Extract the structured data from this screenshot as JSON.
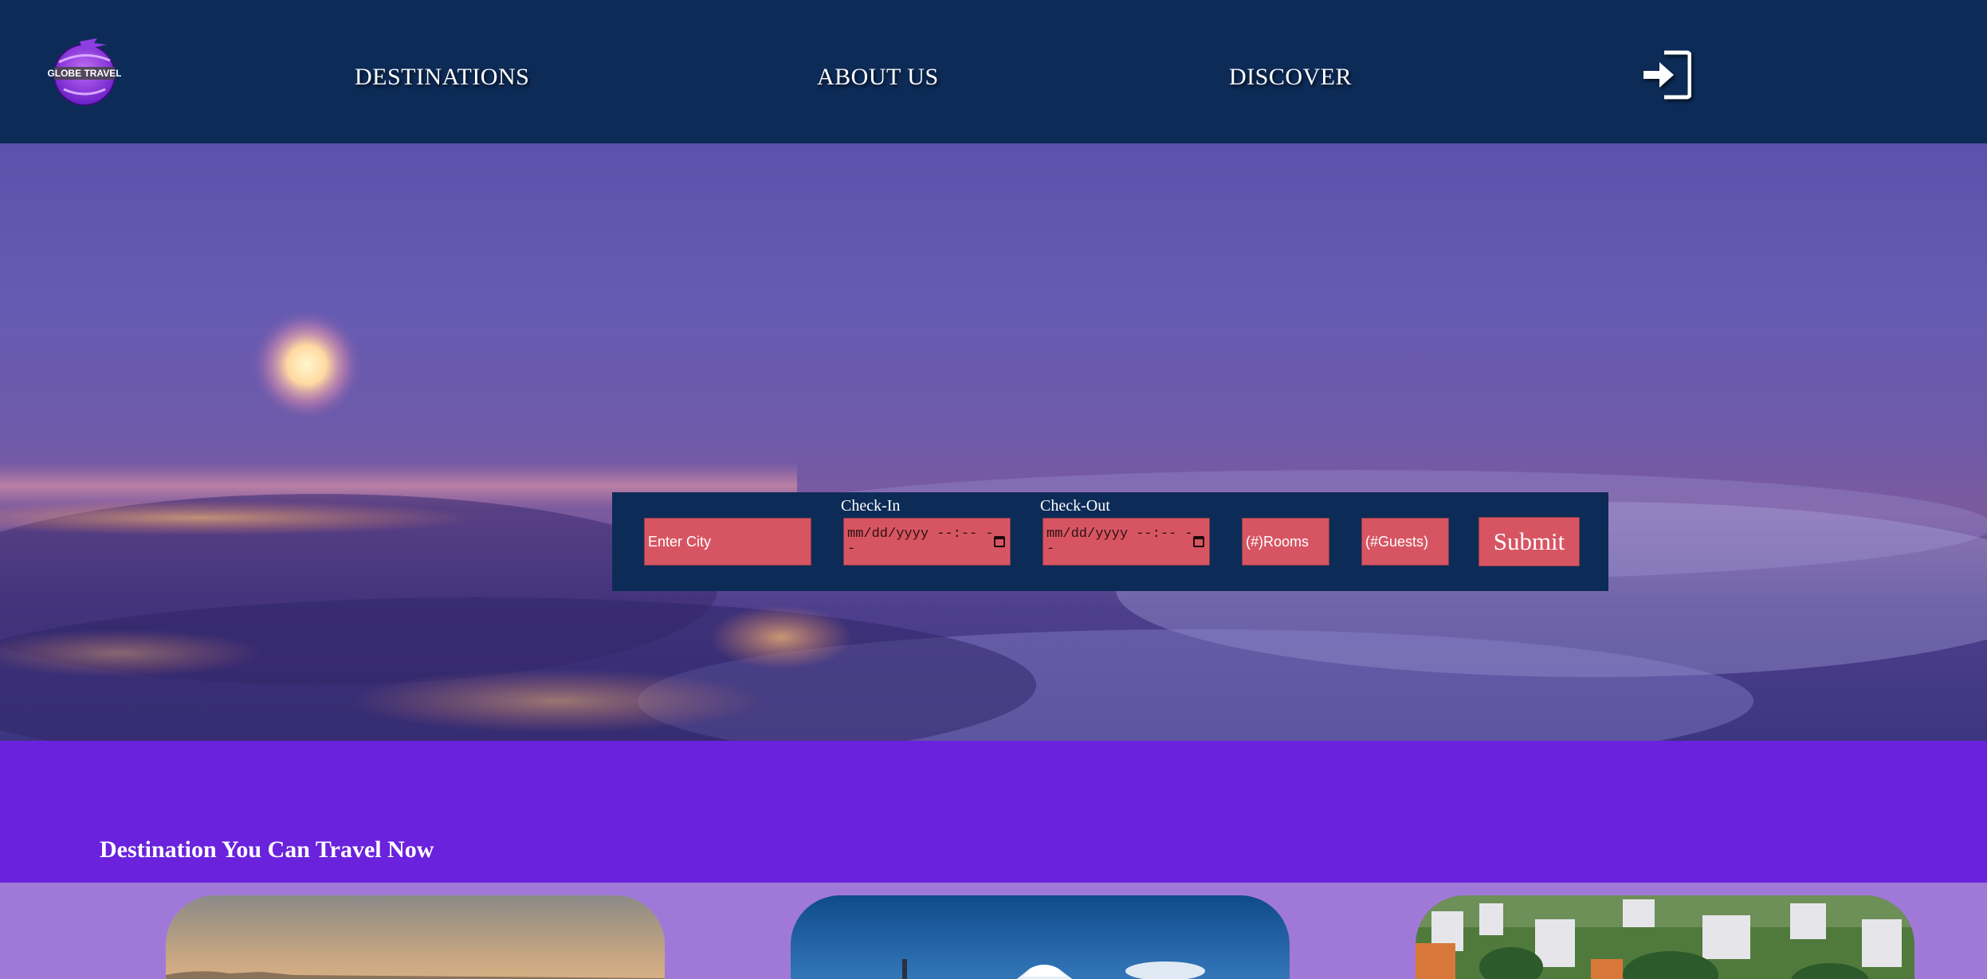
{
  "header": {
    "logo_text": "GLOBE TRAVEL",
    "nav": [
      {
        "label": "DESTINATIONS"
      },
      {
        "label": "ABOUT US"
      },
      {
        "label": "DISCOVER"
      }
    ],
    "login_icon": "sign-in-icon"
  },
  "search": {
    "city_placeholder": "Enter City",
    "checkin_label": "Check-In",
    "checkin_value": "mm/dd/yyyy --:-- --",
    "checkout_label": "Check-Out",
    "checkout_value": "mm/dd/yyyy --:-- --",
    "rooms_placeholder": "(#)Rooms",
    "guests_placeholder": "(#Guests)",
    "submit_label": "Submit"
  },
  "destinations": {
    "title": "Destination You Can Travel Now",
    "cards": [
      {
        "image": "sunset-city-photo"
      },
      {
        "image": "mount-fuji-photo"
      },
      {
        "image": "coastal-town-photo"
      }
    ]
  },
  "colors": {
    "header_bg": "#0d2b57",
    "field_bg": "#d75563",
    "section_band": "#6a22dd",
    "page_bg": "#a079d8"
  }
}
